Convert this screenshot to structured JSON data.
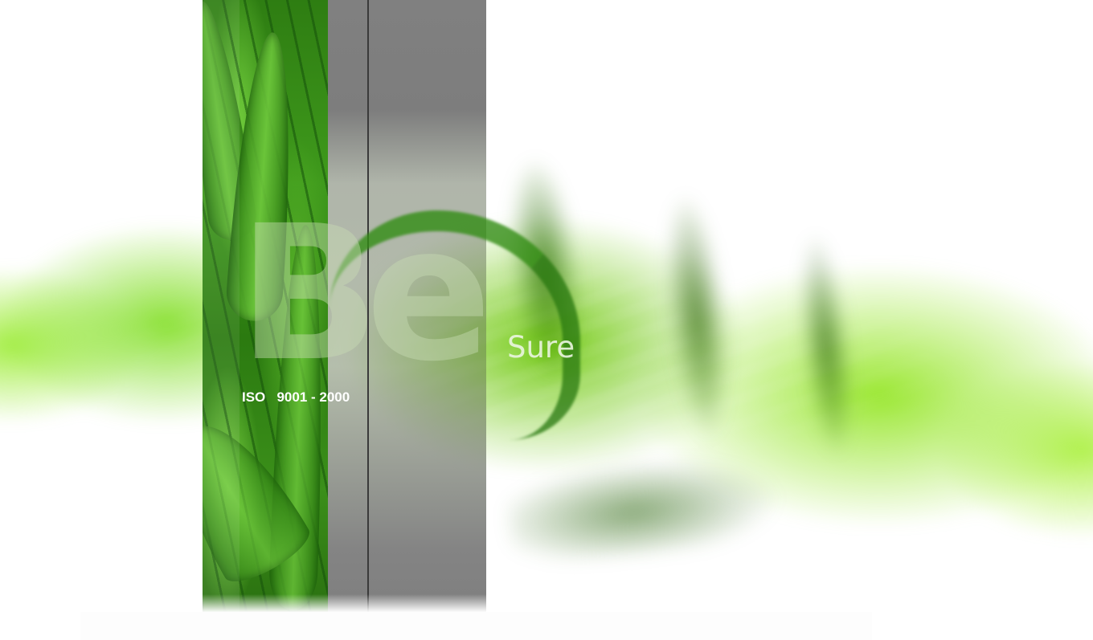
{
  "splash": {
    "headline": "Be",
    "tagline": "Sure",
    "certification": "ISO   9001 - 2000"
  },
  "colors": {
    "accent_green": "#6fd21e",
    "panel_gray": "#808080",
    "background": "#ffffff"
  }
}
